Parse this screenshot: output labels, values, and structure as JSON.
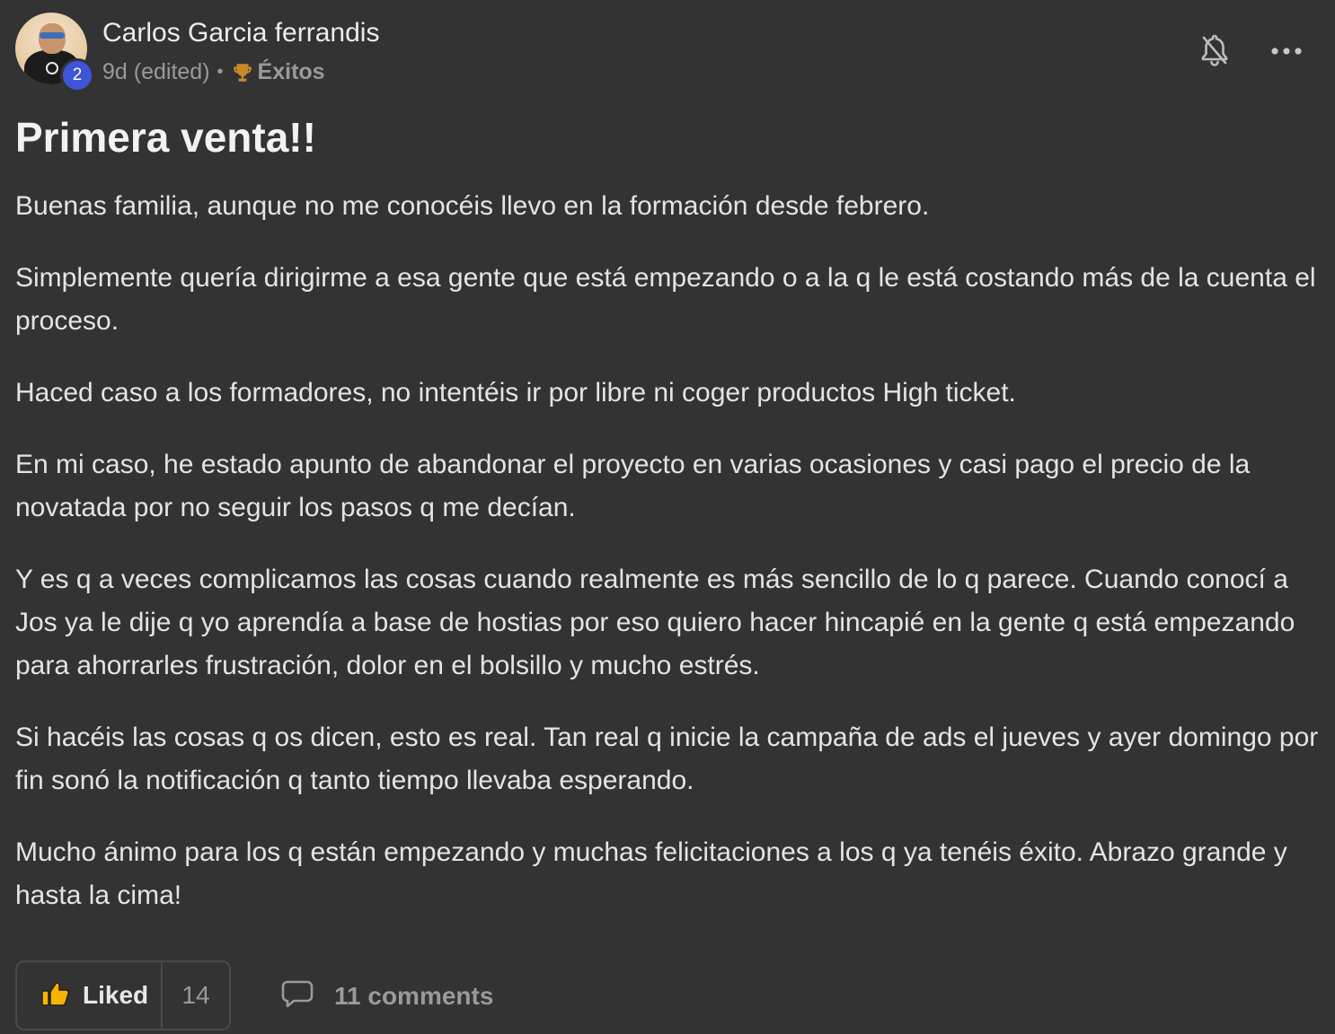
{
  "author": {
    "name": "Carlos Garcia ferrandis",
    "level": "2",
    "avatar_icon": "user-avatar"
  },
  "meta": {
    "time": "9d (edited)",
    "separator": "•",
    "category_icon": "trophy-icon",
    "category": "Éxitos"
  },
  "actions": {
    "notification_icon": "bell-off-icon",
    "more_icon": "more-horizontal-icon"
  },
  "post": {
    "title": "Primera venta!!",
    "paragraphs": [
      "Buenas familia, aunque no me conocéis llevo en la formación desde febrero.",
      "Simplemente quería dirigirme a esa gente que está empezando o a la q le está costando más de la cuenta el proceso.",
      "Haced caso a los formadores, no intentéis ir por libre ni coger productos High ticket.",
      "En mi caso, he estado apunto de abandonar el proyecto en varias ocasiones y casi pago el precio de la novatada por no seguir los pasos q me decían.",
      "Y es q a veces complicamos las cosas cuando realmente es más sencillo de lo q parece. Cuando conocí a Jos ya le dije q yo aprendía a base de hostias por eso quiero hacer hincapié en la gente q está empezando para ahorrarles frustración, dolor en el bolsillo y mucho estrés.",
      "Si hacéis las cosas q os dicen, esto es real. Tan real q inicie la campaña de ads el jueves y ayer domingo por fin sonó la notificación q tanto tiempo llevaba esperando.",
      "Mucho ánimo para los q están empezando y muchas felicitaciones a los q ya tenéis éxito. Abrazo grande y hasta la cima!"
    ]
  },
  "footer": {
    "like_label": "Liked",
    "like_count": "14",
    "like_icon": "thumbs-up-icon",
    "comments_label": "11 comments",
    "comments_icon": "comment-icon"
  },
  "colors": {
    "background": "#333333",
    "text": "#e4e4e4",
    "muted": "#9a9a9a",
    "badge": "#3d55d6",
    "like": "#f6b300"
  }
}
